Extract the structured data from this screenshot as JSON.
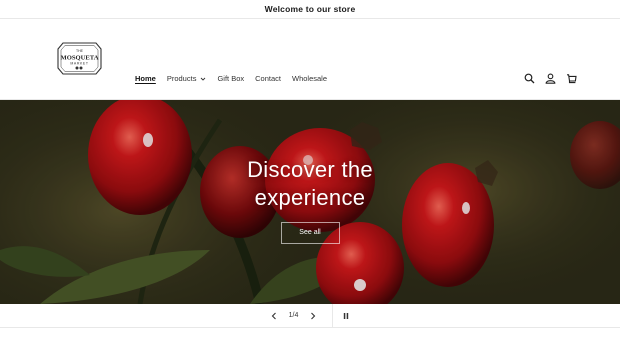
{
  "announcement": {
    "text": "Welcome to our store"
  },
  "logo": {
    "top": "THE",
    "name": "MOSQUETA",
    "sub": "MARKET"
  },
  "nav": {
    "items": [
      {
        "label": "Home"
      },
      {
        "label": "Products"
      },
      {
        "label": "Gift Box"
      },
      {
        "label": "Contact"
      },
      {
        "label": "Wholesale"
      }
    ]
  },
  "header_icons": [
    "search-icon",
    "account-icon",
    "cart-icon"
  ],
  "hero": {
    "title_line1": "Discover the",
    "title_line2": "experience",
    "button_label": "See all"
  },
  "slider": {
    "counter": "1/4"
  },
  "colors": {
    "accent": "#121212",
    "berry": "#c8141a",
    "foliage": "#3b4a22"
  }
}
